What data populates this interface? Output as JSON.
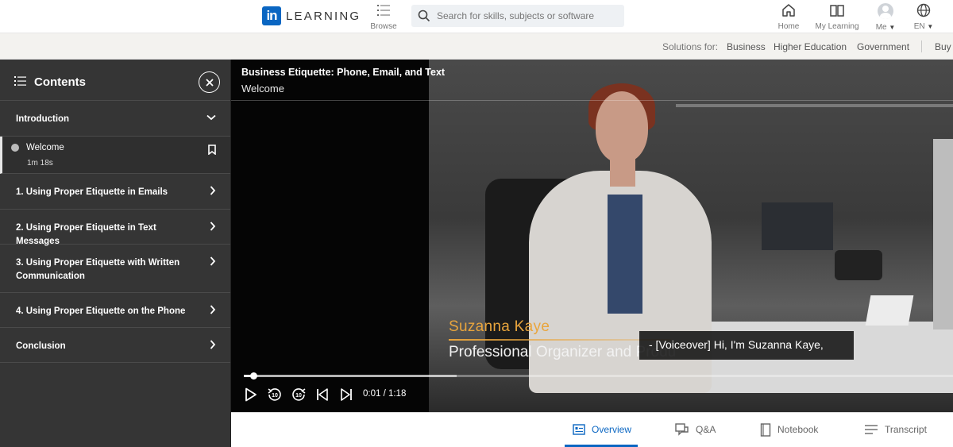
{
  "header": {
    "logo_mark": "in",
    "logo_text": "LEARNING",
    "browse_label": "Browse",
    "search_placeholder": "Search for skills, subjects or software",
    "nav": {
      "home": "Home",
      "my_learning": "My Learning",
      "me": "Me",
      "language": "EN"
    }
  },
  "solutions_bar": {
    "label": "Solutions for:",
    "links": [
      "Business",
      "Higher Education",
      "Government",
      "Buy"
    ]
  },
  "sidebar": {
    "title": "Contents",
    "sections": [
      {
        "label": "Introduction",
        "expanded": true,
        "lessons": [
          {
            "title": "Welcome",
            "duration": "1m 18s"
          }
        ]
      },
      {
        "label": "1. Using Proper Etiquette in Emails"
      },
      {
        "label": "2. Using Proper Etiquette in Text Messages"
      },
      {
        "label": "3. Using Proper Etiquette with Written Communication"
      },
      {
        "label": "4. Using Proper Etiquette on the Phone"
      },
      {
        "label": "Conclusion"
      }
    ]
  },
  "video": {
    "course_title": "Business Etiquette: Phone, Email, and Text",
    "video_title": "Welcome",
    "lower_third_name": "Suzanna Kaye",
    "lower_third_role": "Professional Organizer and Produ",
    "caption": "- [Voiceover] Hi, I'm Suzanna Kaye,",
    "time_display": "0:01 / 1:18",
    "progress_fraction": 0.013,
    "buffered_fraction": 0.3
  },
  "tabs": {
    "items": [
      "Overview",
      "Q&A",
      "Notebook",
      "Transcript"
    ],
    "active": "Overview"
  },
  "colors": {
    "brand": "#0a66c2",
    "sidebar_bg": "#353535",
    "name_accent": "#e9a53d"
  }
}
